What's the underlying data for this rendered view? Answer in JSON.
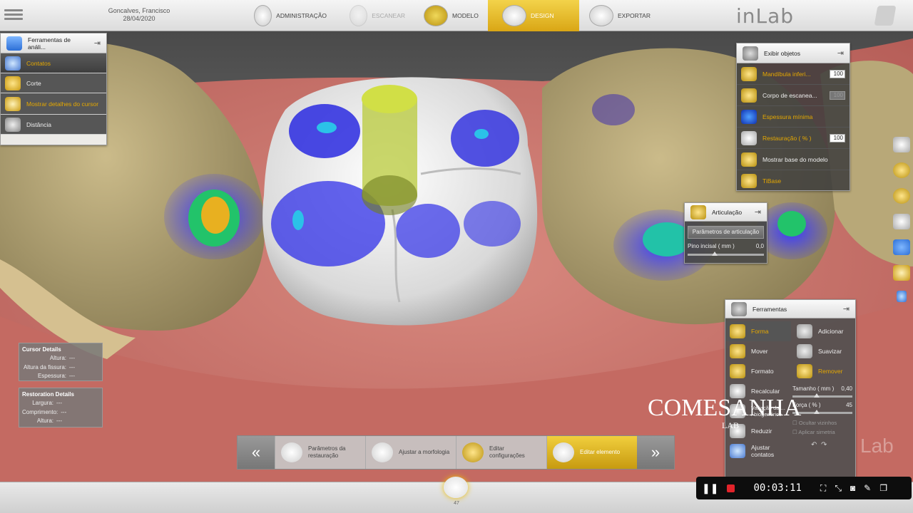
{
  "header": {
    "patient_name": "Goncalves, Francisco",
    "date": "28/04/2020",
    "steps": [
      {
        "label": "ADMINISTRAÇÃO",
        "state": "normal"
      },
      {
        "label": "ESCANEAR",
        "state": "disabled"
      },
      {
        "label": "MODELO",
        "state": "normal"
      },
      {
        "label": "DESIGN",
        "state": "active"
      },
      {
        "label": "EXPORTAR",
        "state": "normal"
      }
    ],
    "brand": "inLab"
  },
  "analysis_panel": {
    "title": "Ferramentas de análi...",
    "items": [
      {
        "label": "Contatos",
        "selected": true
      },
      {
        "label": "Corte",
        "selected": false
      },
      {
        "label": "Mostrar detalhes do cursor",
        "selected": false,
        "highlight": true
      },
      {
        "label": "Distância",
        "selected": false
      }
    ]
  },
  "objects_panel": {
    "title": "Exibir objetos",
    "items": [
      {
        "label": "Mandíbula inferi...",
        "value": "100",
        "gold": true
      },
      {
        "label": "Corpo de escanea...",
        "value": "100",
        "gold": false,
        "disabled_value": true
      },
      {
        "label": "Espessura mínima",
        "value": "",
        "gold": true
      },
      {
        "label": "Restauração ( % )",
        "value": "100",
        "gold": true
      },
      {
        "label": "Mostrar base do modelo",
        "value": "",
        "gold": false
      },
      {
        "label": "TiBase",
        "value": "",
        "gold": true
      }
    ]
  },
  "articulation_panel": {
    "title": "Articulação",
    "button": "Parâmetros de articulação",
    "field_label": "Pino incisal ( mm )",
    "field_value": "0,0"
  },
  "tools_panel": {
    "title": "Ferramentas",
    "left": [
      {
        "label": "Forma",
        "active": true
      },
      {
        "label": "Mover",
        "active": false
      },
      {
        "label": "Formato",
        "active": false
      },
      {
        "label": "Recalcular",
        "active": false
      },
      {
        "label": "Variação da ... / biogenérico",
        "active": false
      },
      {
        "label": "Reduzir",
        "active": false
      },
      {
        "label": "Ajustar contatos",
        "active": false
      }
    ],
    "right": [
      {
        "label": "Adicionar",
        "active": false
      },
      {
        "label": "Suavizar",
        "active": false
      },
      {
        "label": "Remover",
        "active": true
      }
    ],
    "size_label": "Tamanho ( mm )",
    "size_value": "0,40",
    "strength_label": "Força ( % )",
    "strength_value": "45",
    "checkbox1": "Ocultar vizinhos",
    "checkbox2": "Aplicar simetria"
  },
  "cursor_details": {
    "title": "Cursor Details",
    "rows": [
      {
        "label": "Altura:",
        "value": "---"
      },
      {
        "label": "Altura da fissura:",
        "value": "---"
      },
      {
        "label": "Espessura:",
        "value": "---"
      }
    ]
  },
  "restoration_details": {
    "title": "Restoration Details",
    "rows": [
      {
        "label": "Largura:",
        "value": "---"
      },
      {
        "label": "Comprimento:",
        "value": "---"
      },
      {
        "label": "Altura:",
        "value": "---"
      }
    ]
  },
  "workflow": {
    "steps": [
      {
        "label": "Parâmetros da restauração",
        "active": false
      },
      {
        "label": "Ajustar a morfologia",
        "active": false
      },
      {
        "label": "Editar configurações",
        "active": false
      },
      {
        "label": "Editar elemento",
        "active": true
      }
    ]
  },
  "tooth_number": "47",
  "watermark": {
    "main": "COMESANHA",
    "sub": "LAB",
    "corner": "Lab"
  },
  "recorder": {
    "time": "00:03:11"
  },
  "colors": {
    "accent": "#e5a800",
    "active_step": "#d9a615"
  }
}
